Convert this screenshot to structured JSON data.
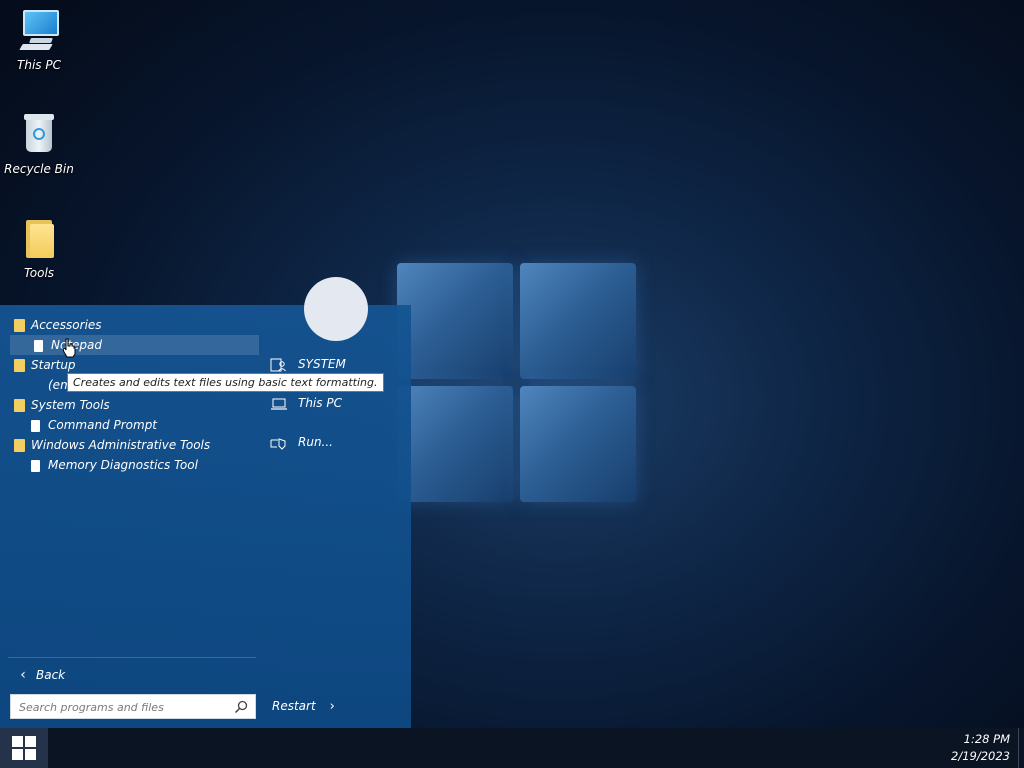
{
  "desktop": {
    "icons": [
      {
        "label": "This PC",
        "icon": "computer-icon"
      },
      {
        "label": "Recycle Bin",
        "icon": "recycle-bin-icon"
      },
      {
        "label": "Tools",
        "icon": "folder-icon"
      }
    ]
  },
  "start_menu": {
    "programs": [
      {
        "label": "Accessories",
        "type": "folder"
      },
      {
        "label": "Notepad",
        "type": "file",
        "selected": true
      },
      {
        "label": "Startup",
        "type": "folder"
      },
      {
        "label": "(empty)",
        "type": "placeholder"
      },
      {
        "label": "System Tools",
        "type": "folder"
      },
      {
        "label": "Command Prompt",
        "type": "file"
      },
      {
        "label": "Windows Administrative Tools",
        "type": "folder"
      },
      {
        "label": "Memory Diagnostics Tool",
        "type": "file"
      }
    ],
    "back_label": "Back",
    "search": {
      "placeholder": "Search programs and files",
      "value": ""
    },
    "right_items": [
      {
        "label": "SYSTEM",
        "icon": "user-folder-icon"
      },
      {
        "label": "This PC",
        "icon": "laptop-icon"
      },
      {
        "label": "Run...",
        "icon": "run-icon"
      }
    ],
    "restart_label": "Restart"
  },
  "tooltip": {
    "text": "Creates and edits text files using basic text formatting."
  },
  "taskbar": {
    "time": "1:28 PM",
    "date": "2/19/2023"
  },
  "colors": {
    "start_menu_bg": "#155492",
    "taskbar_bg": "#0b1423",
    "tooltip_border": "#767676"
  }
}
